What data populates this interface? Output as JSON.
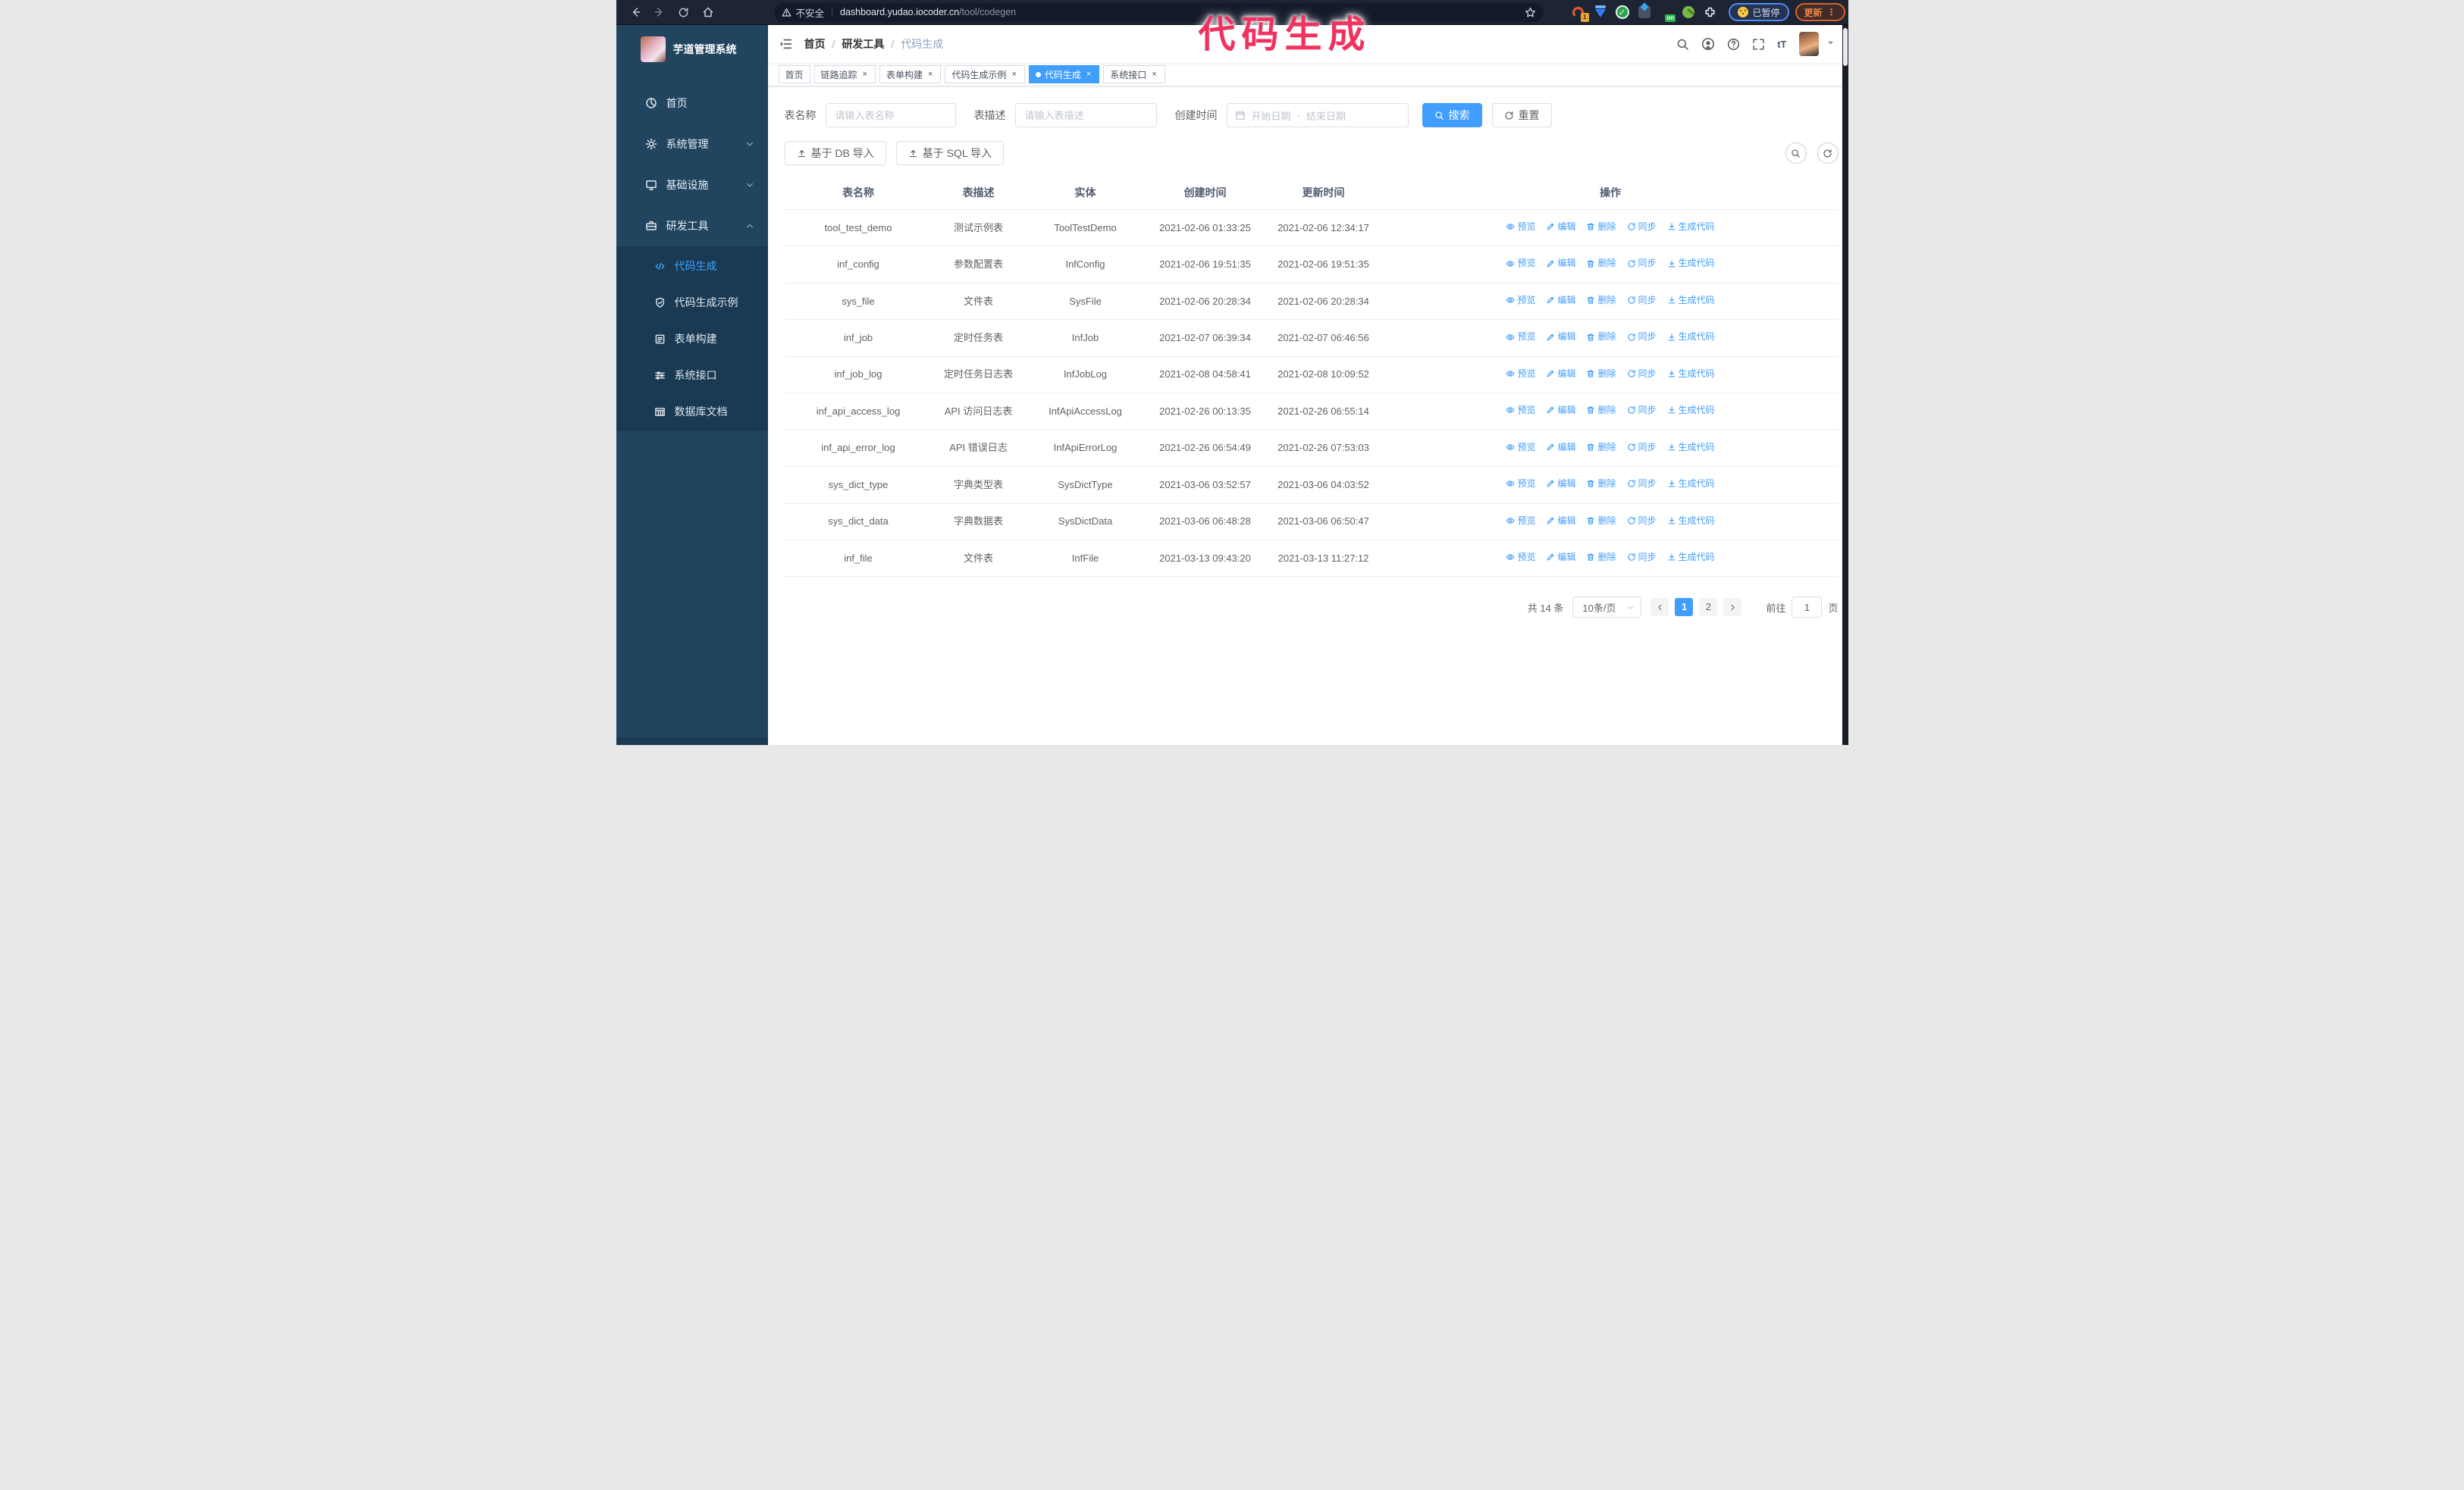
{
  "colors": {
    "accent": "#409eff",
    "sidebar_bg": "#21455f",
    "submenu_bg": "#1a3a53",
    "chrome_bg": "#1d2434",
    "annotation": "#f0325f",
    "active_menu_text": "#3da2ff"
  },
  "browser": {
    "security_label": "不安全",
    "url_host": "dashboard.yudao.iocoder.cn",
    "url_path": "/tool/codegen",
    "extension_badge": "1",
    "paused_label": "已暂停",
    "update_label": "更新",
    "update_dots": "⋮"
  },
  "annotation": {
    "text": "代码生成"
  },
  "sidebar": {
    "title": "芋道管理系统",
    "items": [
      {
        "label": "首页"
      },
      {
        "label": "系统管理"
      },
      {
        "label": "基础设施"
      },
      {
        "label": "研发工具"
      }
    ],
    "submenu": [
      {
        "label": "代码生成",
        "active": true
      },
      {
        "label": "代码生成示例",
        "active": false
      },
      {
        "label": "表单构建",
        "active": false
      },
      {
        "label": "系统接口",
        "active": false
      },
      {
        "label": "数据库文档",
        "active": false
      }
    ]
  },
  "header": {
    "breadcrumb_home": "首页",
    "breadcrumb_section": "研发工具",
    "breadcrumb_current": "代码生成"
  },
  "tabs": [
    {
      "label": "首页",
      "active": false,
      "closable": false
    },
    {
      "label": "链路追踪",
      "active": false,
      "closable": true
    },
    {
      "label": "表单构建",
      "active": false,
      "closable": true
    },
    {
      "label": "代码生成示例",
      "active": false,
      "closable": true
    },
    {
      "label": "代码生成",
      "active": true,
      "closable": true
    },
    {
      "label": "系统接口",
      "active": false,
      "closable": true
    }
  ],
  "search": {
    "name_label": "表名称",
    "name_placeholder": "请输入表名称",
    "desc_label": "表描述",
    "desc_placeholder": "请输入表描述",
    "time_label": "创建时间",
    "start_placeholder": "开始日期",
    "range_separator": "-",
    "end_placeholder": "结束日期",
    "search_label": "搜索",
    "reset_label": "重置"
  },
  "toolbar": {
    "import_db_label": "基于 DB 导入",
    "import_sql_label": "基于 SQL 导入"
  },
  "table": {
    "columns": [
      "表名称",
      "表描述",
      "实体",
      "创建时间",
      "更新时间",
      "操作"
    ],
    "actions": [
      "预览",
      "编辑",
      "删除",
      "同步",
      "生成代码"
    ],
    "rows": [
      {
        "name": "tool_test_demo",
        "desc": "测试示例表",
        "entity": "ToolTestDemo",
        "created": "2021-02-06 01:33:25",
        "updated": "2021-02-06 12:34:17"
      },
      {
        "name": "inf_config",
        "desc": "参数配置表",
        "entity": "InfConfig",
        "created": "2021-02-06 19:51:35",
        "updated": "2021-02-06 19:51:35"
      },
      {
        "name": "sys_file",
        "desc": "文件表",
        "entity": "SysFile",
        "created": "2021-02-06 20:28:34",
        "updated": "2021-02-06 20:28:34"
      },
      {
        "name": "inf_job",
        "desc": "定时任务表",
        "entity": "InfJob",
        "created": "2021-02-07 06:39:34",
        "updated": "2021-02-07 06:46:56"
      },
      {
        "name": "inf_job_log",
        "desc": "定时任务日志表",
        "entity": "InfJobLog",
        "created": "2021-02-08 04:58:41",
        "updated": "2021-02-08 10:09:52"
      },
      {
        "name": "inf_api_access_log",
        "desc": "API 访问日志表",
        "entity": "InfApiAccessLog",
        "created": "2021-02-26 00:13:35",
        "updated": "2021-02-26 06:55:14"
      },
      {
        "name": "inf_api_error_log",
        "desc": "API 错误日志",
        "entity": "InfApiErrorLog",
        "created": "2021-02-26 06:54:49",
        "updated": "2021-02-26 07:53:03"
      },
      {
        "name": "sys_dict_type",
        "desc": "字典类型表",
        "entity": "SysDictType",
        "created": "2021-03-06 03:52:57",
        "updated": "2021-03-06 04:03:52"
      },
      {
        "name": "sys_dict_data",
        "desc": "字典数据表",
        "entity": "SysDictData",
        "created": "2021-03-06 06:48:28",
        "updated": "2021-03-06 06:50:47"
      },
      {
        "name": "inf_file",
        "desc": "文件表",
        "entity": "InfFile",
        "created": "2021-03-13 09:43:20",
        "updated": "2021-03-13 11:27:12"
      }
    ]
  },
  "pagination": {
    "total_label": "共 14 条",
    "page_size_label": "10条/页",
    "pages": [
      {
        "label": "1",
        "active": true
      },
      {
        "label": "2",
        "active": false
      }
    ],
    "goto_label": "前往",
    "goto_value": "1",
    "goto_suffix": "页"
  }
}
